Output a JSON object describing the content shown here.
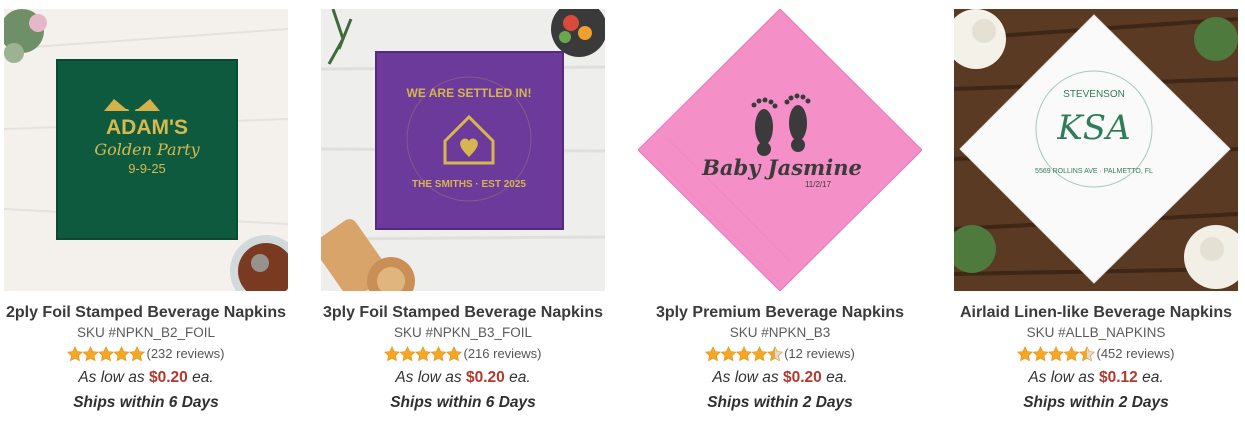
{
  "colors": {
    "price": "#b5382e",
    "star": "#f5a623",
    "star_empty": "#dddddd"
  },
  "products": [
    {
      "name": "2ply Foil Stamped Beverage Napkins",
      "sku": "SKU #NPKN_B2_FOIL",
      "rating": 5,
      "reviews": "(232 reviews)",
      "price_prefix": "As low as",
      "price": "$0.20",
      "price_suffix": "ea.",
      "ships": "Ships within 6 Days",
      "napkin_text": {
        "line1": "ADAM'S",
        "line2": "Golden Party",
        "line3": "9-9-25"
      }
    },
    {
      "name": "3ply Foil Stamped Beverage Napkins",
      "sku": "SKU #NPKN_B3_FOIL",
      "rating": 5,
      "reviews": "(216 reviews)",
      "price_prefix": "As low as",
      "price": "$0.20",
      "price_suffix": "ea.",
      "ships": "Ships within 6 Days",
      "napkin_text": {
        "line1": "WE ARE SETTLED IN!",
        "line2": "THE SMITHS · EST 2025"
      }
    },
    {
      "name": "3ply Premium Beverage Napkins",
      "sku": "SKU #NPKN_B3",
      "rating": 4.5,
      "reviews": "(12 reviews)",
      "price_prefix": "As low as",
      "price": "$0.20",
      "price_suffix": "ea.",
      "ships": "Ships within 2 Days",
      "napkin_text": {
        "line1": "Baby Jasmine",
        "line2": "11/2/17"
      }
    },
    {
      "name": "Airlaid Linen-like Beverage Napkins",
      "sku": "SKU #ALLB_NAPKINS",
      "rating": 4.5,
      "reviews": "(452 reviews)",
      "price_prefix": "As low as",
      "price": "$0.12",
      "price_suffix": "ea.",
      "ships": "Ships within 2 Days",
      "napkin_text": {
        "line1": "STEVENSON",
        "line2": "KSA",
        "line3": "5569 ROLLINS AVE · PALMETTO, FL"
      }
    }
  ]
}
